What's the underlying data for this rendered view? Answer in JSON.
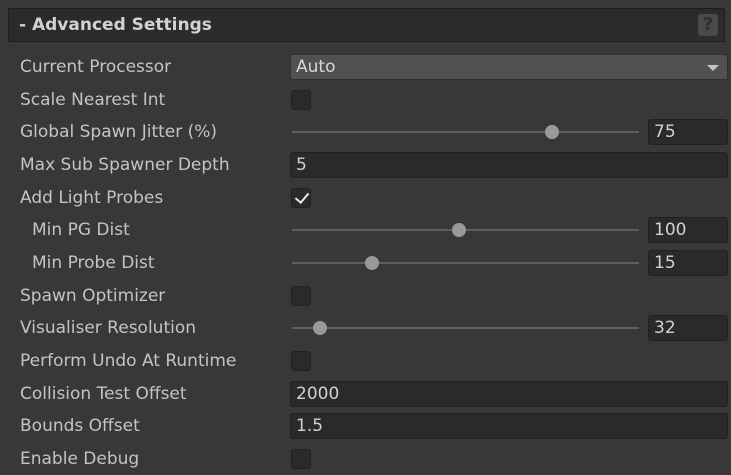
{
  "header": {
    "title": "- Advanced Settings",
    "help_icon_glyph": "?"
  },
  "rows": {
    "current_processor": {
      "label": "Current Processor",
      "value": "Auto"
    },
    "scale_nearest_int": {
      "label": "Scale Nearest Int",
      "checked": false
    },
    "global_spawn_jitter": {
      "label": "Global Spawn Jitter (%)",
      "value": "75",
      "level": 0.75
    },
    "max_sub_spawner_depth": {
      "label": "Max Sub Spawner Depth",
      "value": "5"
    },
    "add_light_probes": {
      "label": "Add Light Probes",
      "checked": true
    },
    "min_pg_dist": {
      "label": "Min PG Dist",
      "value": "100",
      "level": 0.48
    },
    "min_probe_dist": {
      "label": "Min Probe Dist",
      "value": "15",
      "level": 0.23
    },
    "spawn_optimizer": {
      "label": "Spawn Optimizer",
      "checked": false
    },
    "visualiser_resolution": {
      "label": "Visualiser Resolution",
      "value": "32",
      "level": 0.08
    },
    "perform_undo_at_runtime": {
      "label": "Perform Undo At Runtime",
      "checked": false
    },
    "collision_test_offset": {
      "label": "Collision Test Offset",
      "value": "2000"
    },
    "bounds_offset": {
      "label": "Bounds Offset",
      "value": "1.5"
    },
    "enable_debug": {
      "label": "Enable Debug",
      "checked": false
    }
  }
}
